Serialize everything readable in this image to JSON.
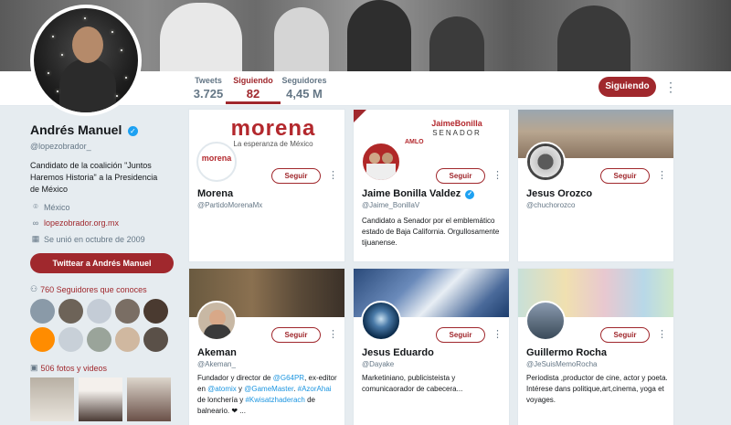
{
  "header": {
    "nav": [
      {
        "label": "Tweets",
        "value": "3.725"
      },
      {
        "label": "Siguiendo",
        "value": "82"
      },
      {
        "label": "Seguidores",
        "value": "4,45 M"
      }
    ],
    "following_button": "Siguiendo",
    "more_icon": "⋮"
  },
  "profile": {
    "name": "Andrés Manuel",
    "verified_icon": "✓",
    "handle": "@lopezobrador_",
    "bio": "Candidato de la coalición \"Juntos Haremos Historia\" a la Presidencia de México",
    "location": "México",
    "website": "lopezobrador.org.mx",
    "joined": "Se unió en octubre de 2009",
    "tweet_to_button": "Twittear a Andrés Manuel",
    "followers_you_know": "760 Seguidores que conoces",
    "photos_videos": "506 fotos y videos",
    "icons": {
      "location": "location-pin-icon",
      "link": "link-icon",
      "calendar": "calendar-icon",
      "people": "people-icon",
      "media": "image-icon"
    }
  },
  "cards": [
    {
      "name": "Morena",
      "handle": "@PartidoMorenaMx",
      "bio": "",
      "follow": "Seguir",
      "banner_title": "morena",
      "banner_sub": "La esperanza de México",
      "avatar_text": "morena"
    },
    {
      "name": "Jaime Bonilla Valdez",
      "verified": true,
      "handle": "@Jaime_BonillaV",
      "bio": "Candidato a Senador por el emblemático estado de Baja California. Orgullosamente tijuanense.",
      "follow": "Seguir",
      "banner_title": "JaimeBonilla",
      "banner_sub": "SENADOR",
      "banner_extra": "AMLO"
    },
    {
      "name": "Jesus Orozco",
      "handle": "@chuchorozco",
      "bio": "",
      "follow": "Seguir"
    },
    {
      "name": "Akeman",
      "handle": "@Akeman_",
      "follow": "Seguir",
      "bio_parts": [
        "Fundador y director de ",
        "@G64PR",
        ", ex-editor en ",
        "@atomix",
        " y ",
        "@GameMaster",
        ". ",
        "#AzorAhai",
        " de lonchería y ",
        "#Kwisatzhaderach",
        " de balneario. ❤ ..."
      ]
    },
    {
      "name": "Jesus Eduardo",
      "handle": "@Dayake",
      "bio": "Marketiniano, publicisteista y comunicaorador de cabecera...",
      "follow": "Seguir"
    },
    {
      "name": "Guillermo Rocha",
      "handle": "@JeSuisMemoRocha",
      "bio": "Periodista ,productor de cine, actor y poeta. Intérese dans politique,art,cinema, yoga et voyages.",
      "follow": "Seguir"
    }
  ],
  "colors": {
    "accent": "#a0282d",
    "link": "#1b95e0",
    "muted": "#657786"
  }
}
